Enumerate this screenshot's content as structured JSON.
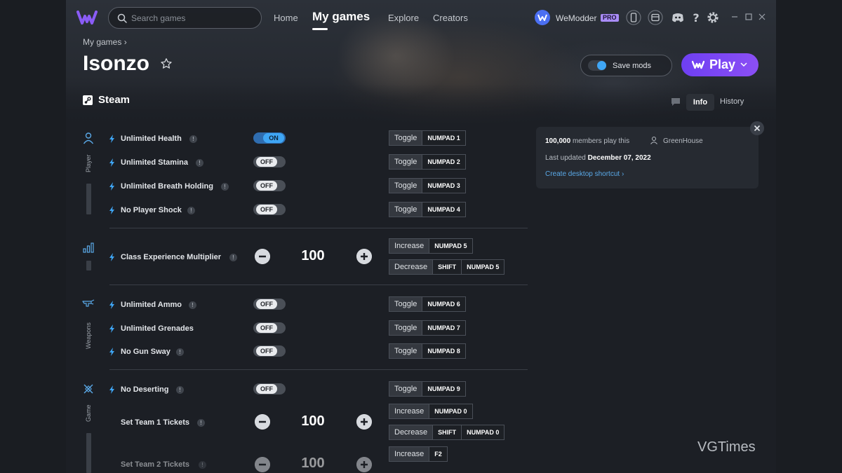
{
  "topbar": {
    "search_placeholder": "Search games",
    "nav": [
      "Home",
      "My games",
      "Explore",
      "Creators"
    ],
    "active_nav": "My games",
    "user_name": "WeModder",
    "pro_badge": "PRO"
  },
  "header": {
    "breadcrumb": "My games",
    "title": "Isonzo",
    "save_mods_label": "Save mods",
    "play_label": "Play",
    "platform": "Steam",
    "tabs": [
      "Info",
      "History"
    ]
  },
  "info": {
    "members_count": "100,000",
    "members_suffix": "members play this",
    "author": "GreenHouse",
    "updated_prefix": "Last updated",
    "updated_date": "December 07, 2022",
    "shortcut": "Create desktop shortcut"
  },
  "categories": [
    "Player",
    "Weapons",
    "Game"
  ],
  "mods": [
    {
      "name": "Unlimited Health",
      "control": "toggle",
      "state": "ON",
      "action": "Toggle",
      "keys": [
        "NUMPAD 1"
      ]
    },
    {
      "name": "Unlimited Stamina",
      "control": "toggle",
      "state": "OFF",
      "action": "Toggle",
      "keys": [
        "NUMPAD 2"
      ]
    },
    {
      "name": "Unlimited Breath Holding",
      "control": "toggle",
      "state": "OFF",
      "action": "Toggle",
      "keys": [
        "NUMPAD 3"
      ]
    },
    {
      "name": "No Player Shock",
      "control": "toggle",
      "state": "OFF",
      "action": "Toggle",
      "keys": [
        "NUMPAD 4"
      ]
    },
    {
      "name": "Class Experience Multiplier",
      "control": "stepper",
      "value": "100",
      "increase": {
        "action": "Increase",
        "keys": [
          "NUMPAD 5"
        ]
      },
      "decrease": {
        "action": "Decrease",
        "keys": [
          "SHIFT",
          "NUMPAD 5"
        ]
      }
    },
    {
      "name": "Unlimited Ammo",
      "control": "toggle",
      "state": "OFF",
      "action": "Toggle",
      "keys": [
        "NUMPAD 6"
      ]
    },
    {
      "name": "Unlimited Grenades",
      "control": "toggle",
      "state": "OFF",
      "action": "Toggle",
      "keys": [
        "NUMPAD 7"
      ]
    },
    {
      "name": "No Gun Sway",
      "control": "toggle",
      "state": "OFF",
      "action": "Toggle",
      "keys": [
        "NUMPAD 8"
      ]
    },
    {
      "name": "No Deserting",
      "control": "toggle",
      "state": "OFF",
      "action": "Toggle",
      "keys": [
        "NUMPAD 9"
      ]
    },
    {
      "name": "Set Team 1 Tickets",
      "control": "stepper",
      "value": "100",
      "increase": {
        "action": "Increase",
        "keys": [
          "NUMPAD 0"
        ]
      },
      "decrease": {
        "action": "Decrease",
        "keys": [
          "SHIFT",
          "NUMPAD 0"
        ]
      }
    },
    {
      "name": "Set Team 2 Tickets",
      "control": "stepper",
      "value": "100",
      "increase": {
        "action": "Increase",
        "keys": [
          "F2"
        ]
      }
    }
  ],
  "watermark": "VGTimes",
  "colors": {
    "accent": "#3fa6f5",
    "play": "#7b45f4",
    "link": "#5aa9e8"
  }
}
